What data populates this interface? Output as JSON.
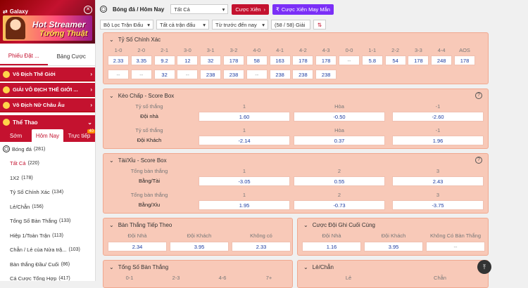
{
  "sidebar": {
    "galaxy_title": "Galaxy",
    "banner_line1": "Hot Streamer",
    "banner_line2": "Tướng Thuật",
    "bet_tabs": [
      "Phiếu Đặt ...",
      "Bảng Cược"
    ],
    "leagues": [
      "Vô Địch Thế Giới",
      "GIẢI VÔ ĐỊCH THẾ GIỚI ...",
      "Vô Địch Nữ Châu Âu"
    ],
    "sport_header": "Thể Thao",
    "sport_tabs": [
      "Sớm",
      "Hôm Nay",
      "Trực tiếp"
    ],
    "live_badge": "40",
    "sport": {
      "label": "Bóng đá",
      "count": "(281)"
    },
    "items": [
      {
        "label": "Tất Cả",
        "count": "(220)"
      },
      {
        "label": "1X2",
        "count": "(178)"
      },
      {
        "label": "Tỷ Số Chính Xác",
        "count": "(134)"
      },
      {
        "label": "Lẻ/Chẵn",
        "count": "(156)"
      },
      {
        "label": "Tổng Số Bàn Thắng",
        "count": "(133)"
      },
      {
        "label": "Hiệp 1/Toàn Trận",
        "count": "(113)"
      },
      {
        "label": "Chẵn / Lẻ của Nửa trậ...",
        "count": "(103)"
      },
      {
        "label": "Bàn thắng Đầu/ Cuối",
        "count": "(86)"
      },
      {
        "label": "Cá Cược Tổng Hợp",
        "count": "(417)"
      }
    ]
  },
  "header": {
    "title": "Bóng đá / Hôm Nay",
    "filter_select": "Tất Cả",
    "cuoc_xien": "Cược Xiên",
    "cuoc_xien_may_man": "Cược Xiên May Mắn",
    "loc_tran": "Bộ Lọc Trận Đấu",
    "tat_ca_tran": "Tất cả trận đấu",
    "tu_truoc": "Từ trước đến nay",
    "giai": "(58 / 58) Giải"
  },
  "exact": {
    "title": "Tỷ Số Chính Xác",
    "headers": [
      "1-0",
      "2-0",
      "2-1",
      "3-0",
      "3-1",
      "3-2",
      "4-0",
      "4-1",
      "4-2",
      "4-3",
      "0-0",
      "1-1",
      "2-2",
      "3-3",
      "4-4",
      "AOS"
    ],
    "row1": [
      "2.33",
      "3.35",
      "9.2",
      "12",
      "32",
      "178",
      "58",
      "163",
      "178",
      "178",
      "--",
      "5.8",
      "54",
      "178",
      "248",
      "178"
    ],
    "row2": [
      "--",
      "--",
      "32",
      "--",
      "238",
      "238",
      "--",
      "238",
      "238",
      "238"
    ]
  },
  "handicap": {
    "title": "Kèo Chấp - Score Box",
    "col_labels": [
      "Tỷ số thắng",
      "Hòa",
      "-1"
    ],
    "col_labels_b": [
      "Tỷ số thắng",
      "Hòa",
      "-1"
    ],
    "h1": "1",
    "h2": "1",
    "home": "Đội nhà",
    "away": "Đội Khách",
    "home_vals": [
      "1.60",
      "-0.50",
      "-2.60"
    ],
    "away_vals": [
      "-2.14",
      "0.37",
      "1.96"
    ]
  },
  "overunder": {
    "title": "Tài/Xỉu - Score Box",
    "lbl": "Tổng bàn thắng",
    "cols": [
      "1",
      "2",
      "3"
    ],
    "over": "Bằng/Tài",
    "under": "Bằng/Xỉu",
    "over_vals": [
      "-3.05",
      "0.55",
      "2.43"
    ],
    "under_vals": [
      "1.95",
      "-0.73",
      "-3.75"
    ]
  },
  "next_goal": {
    "title": "Bàn Thắng Tiếp Theo",
    "cols": [
      "Đội Nhà",
      "Đội Khách",
      "Không có"
    ],
    "vals": [
      "2.34",
      "3.95",
      "2.33"
    ]
  },
  "last_goal": {
    "title": "Cược Đội Ghi Cuối Cùng",
    "cols": [
      "Đội Nhà",
      "Đội Khách",
      "Không Có Bàn Thắng"
    ],
    "vals": [
      "1.16",
      "3.95",
      "--"
    ]
  },
  "total_goals": {
    "title": "Tổng Số Bàn Thắng",
    "cols": [
      "0-1",
      "2-3",
      "4-6",
      "7+"
    ]
  },
  "odd_even": {
    "title": "Lẻ/Chẵn",
    "cols": [
      "Lẻ",
      "Chẵn"
    ]
  }
}
